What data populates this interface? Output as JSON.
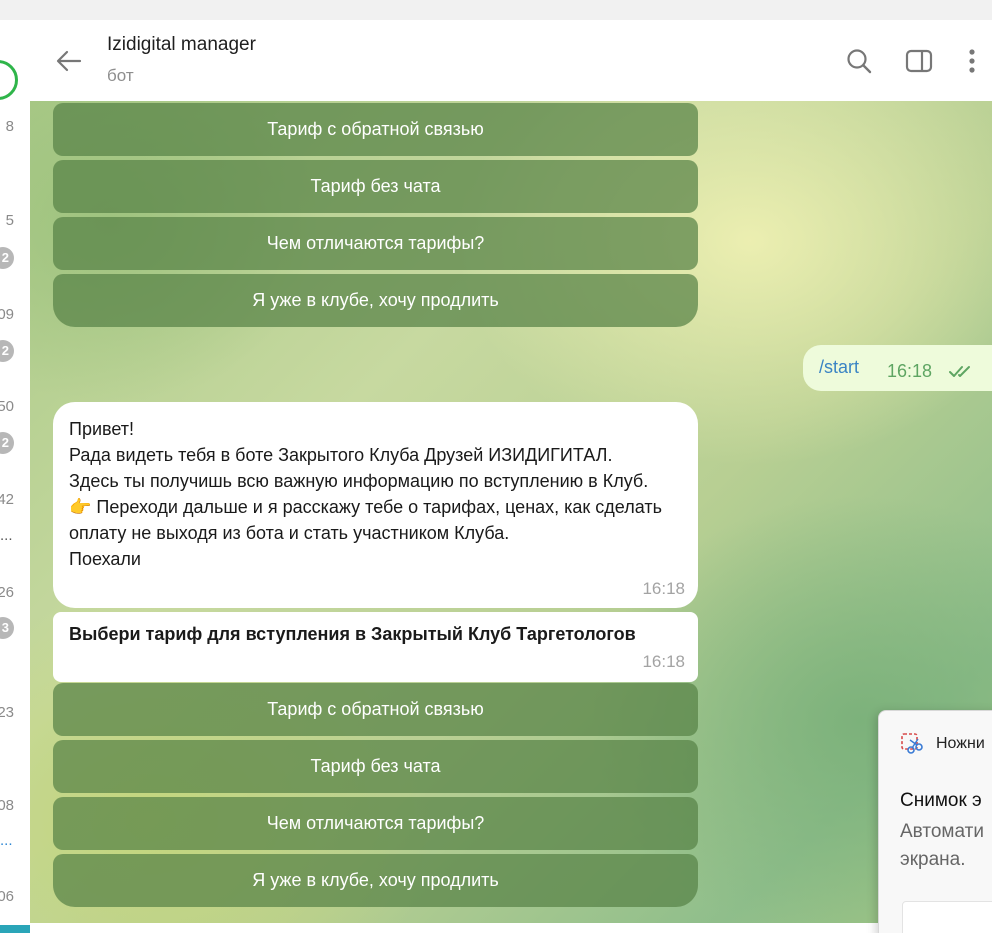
{
  "chat_list": {
    "times": [
      "8",
      "5",
      "09",
      "50",
      "42",
      "26",
      "23",
      "08",
      "06"
    ],
    "badges": [
      "2",
      "2",
      "2",
      "3"
    ],
    "ellipses": [
      "...",
      "..."
    ]
  },
  "header": {
    "title": "Izidigital manager",
    "subtitle": "бот"
  },
  "keyboard_top": [
    "Тариф с обратной связью",
    "Тариф без чата",
    "Чем отличаются тарифы?",
    "Я уже в клубе, хочу продлить"
  ],
  "outgoing": {
    "text": "/start",
    "time": "16:18"
  },
  "welcome": {
    "text": "Привет!\nРада видеть тебя в боте Закрытого Клуба Друзей ИЗИДИГИТАЛ.\nЗдесь ты получишь всю важную информацию по вступлению в Клуб.\n👉 Переходи дальше и я расскажу тебе о тарифах, ценах, как сделать оплату не выходя из бота и стать участником Клуба.\nПоехали",
    "time": "16:18"
  },
  "choose": {
    "text": "Выбери тариф для вступления в Закрытый Клуб Таргетологов",
    "time": "16:18"
  },
  "keyboard_bottom": [
    "Тариф с обратной связью",
    "Тариф без чата",
    "Чем отличаются тарифы?",
    "Я уже в клубе, хочу продлить"
  ],
  "snip_toast": {
    "app": "Ножни",
    "title": "Снимок э",
    "body": "Автомати экрана."
  },
  "colors": {
    "keyboard_button": "#5a8246",
    "outgoing_bubble": "#eefbdb",
    "link": "#3a84c4",
    "checks": "#5ea562"
  }
}
